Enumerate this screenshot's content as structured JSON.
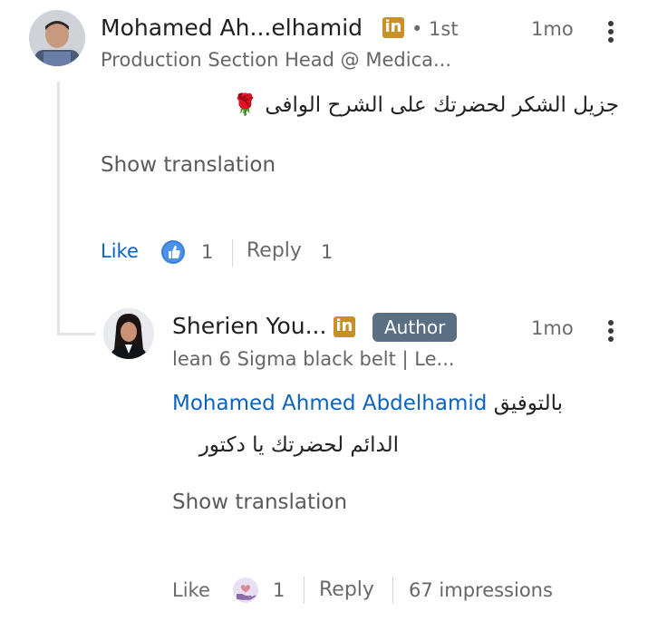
{
  "comment": {
    "author_name": "Mohamed Ah...elhamid",
    "linkedin_badge": "in",
    "connection_degree": "• 1st",
    "time": "1mo",
    "headline": "Production Section Head @ Medica...",
    "text": "جزيل الشكر لحضرتك على الشرح الوافى 🌹",
    "show_translation": "Show translation",
    "like_label": "Like",
    "reaction_icon": "thumbs-up-icon",
    "reaction_count": "1",
    "reply_label": "Reply",
    "reply_count": "1"
  },
  "reply": {
    "author_name": "Sherien You...",
    "linkedin_badge": "in",
    "author_badge": "Author",
    "time": "1mo",
    "headline": "lean 6 Sigma black belt | Le...",
    "mention": "Mohamed Ahmed Abdelhamid",
    "text_line1": "بالتوفيق",
    "text_line2": "الدائم لحضرتك يا دكتور",
    "show_translation": "Show translation",
    "like_label": "Like",
    "reaction_icon": "heart-hand-icon",
    "reaction_count": "1",
    "reply_label": "Reply",
    "impressions": "67 impressions"
  },
  "colors": {
    "link_blue": "#0a63c0",
    "badge_gold": "#c9902a",
    "author_pill": "#5a6e84",
    "thread_line": "#e3e3e3"
  }
}
